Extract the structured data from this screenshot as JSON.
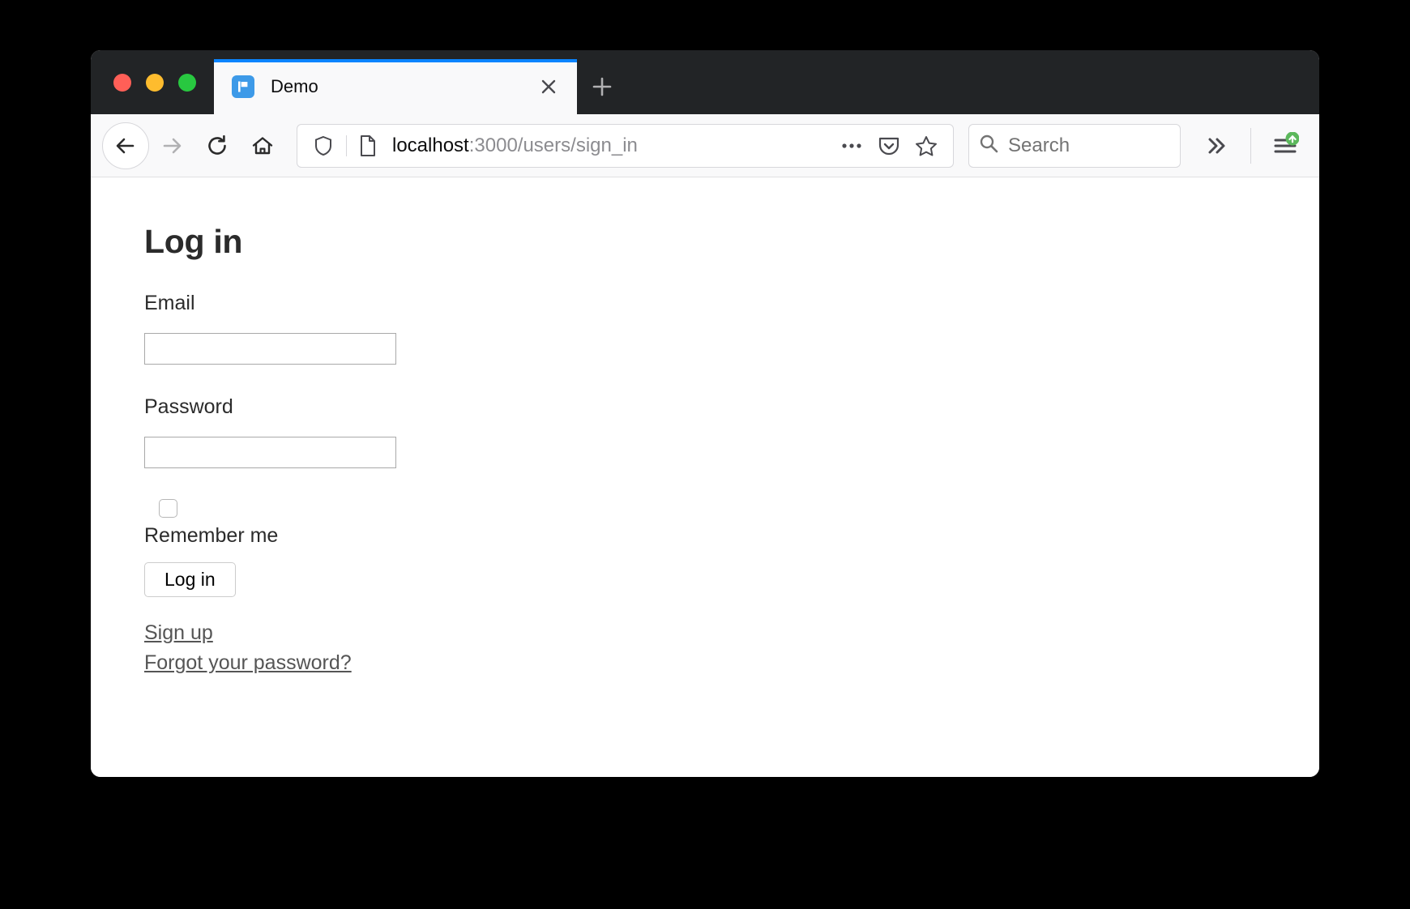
{
  "window": {
    "traffic_lights": [
      {
        "name": "close",
        "color": "#ff5f57"
      },
      {
        "name": "minimize",
        "color": "#febc2e"
      },
      {
        "name": "zoom",
        "color": "#28c840"
      }
    ]
  },
  "tabs": [
    {
      "title": "Demo",
      "favicon": "flag-icon",
      "active": true,
      "close_label": "×"
    }
  ],
  "new_tab": {
    "label": "+",
    "icon": "plus-icon"
  },
  "toolbar": {
    "back": {
      "icon": "back-arrow-icon",
      "enabled": true
    },
    "forward": {
      "icon": "forward-arrow-icon",
      "enabled": false
    },
    "reload": {
      "icon": "reload-icon"
    },
    "home": {
      "icon": "home-icon"
    },
    "overflow": {
      "icon": "chevron-double-right-icon"
    },
    "app_menu": {
      "icon": "hamburger-menu-icon",
      "badge": "update-arrow-badge",
      "badge_color": "#5cb85c"
    }
  },
  "address_bar": {
    "shield_icon": "shield-icon",
    "page_icon": "page-document-icon",
    "url_host": "localhost",
    "url_rest": ":3000/users/sign_in",
    "full_url": "localhost:3000/users/sign_in",
    "actions": [
      {
        "name": "page-actions-icon",
        "label": "•••"
      },
      {
        "name": "pocket-icon"
      },
      {
        "name": "bookmark-star-icon"
      }
    ]
  },
  "search_bar": {
    "icon": "search-icon",
    "placeholder": "Search",
    "value": ""
  },
  "page": {
    "heading": "Log in",
    "email": {
      "label": "Email",
      "value": "",
      "placeholder": ""
    },
    "password": {
      "label": "Password",
      "value": "",
      "placeholder": ""
    },
    "remember_me": {
      "label": "Remember me",
      "checked": false
    },
    "submit_label": "Log in",
    "links": [
      {
        "label": "Sign up"
      },
      {
        "label": "Forgot your password?"
      }
    ]
  }
}
